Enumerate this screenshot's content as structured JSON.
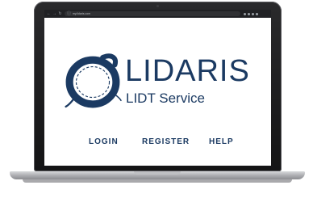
{
  "browser": {
    "url": "my.lidaris.com",
    "icons": [
      "back-arrow-icon",
      "forward-arrow-icon",
      "reload-icon",
      "info-icon",
      "extension-icon",
      "bookmark-icon",
      "profile-icon",
      "menu-icon"
    ]
  },
  "brand": {
    "name": "LIDARIS",
    "subtitle": "LIDT Service",
    "color": "#1b3a62"
  },
  "nav": {
    "items": [
      {
        "label": "LOGIN"
      },
      {
        "label": "REGISTER"
      },
      {
        "label": "HELP"
      }
    ]
  }
}
